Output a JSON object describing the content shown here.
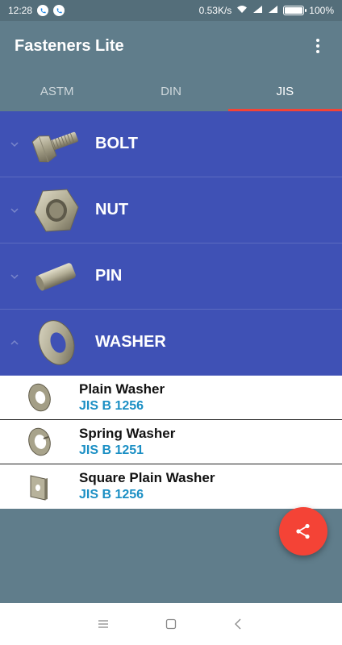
{
  "status_bar": {
    "time": "12:28",
    "speed": "0.53K/s",
    "battery_percent": "100%",
    "battery_level": 1.0
  },
  "app": {
    "title": "Fasteners Lite",
    "overflow_icon": "more-vert-icon"
  },
  "tabs": [
    {
      "label": "ASTM",
      "active": false
    },
    {
      "label": "DIN",
      "active": false
    },
    {
      "label": "JIS",
      "active": true
    }
  ],
  "categories": [
    {
      "label": "BOLT",
      "expanded": false,
      "icon": "bolt-icon"
    },
    {
      "label": "NUT",
      "expanded": false,
      "icon": "nut-icon"
    },
    {
      "label": "PIN",
      "expanded": false,
      "icon": "pin-icon"
    },
    {
      "label": "WASHER",
      "expanded": true,
      "icon": "washer-icon"
    }
  ],
  "washer_items": [
    {
      "name": "Plain Washer",
      "standard": "JIS B 1256",
      "icon": "plain-washer-icon"
    },
    {
      "name": "Spring Washer",
      "standard": "JIS B 1251",
      "icon": "spring-washer-icon"
    },
    {
      "name": "Square Plain Washer",
      "standard": "JIS B 1256",
      "icon": "square-washer-icon"
    }
  ],
  "fab": {
    "icon": "share-icon"
  },
  "nav": [
    "menu-icon",
    "home-icon",
    "back-icon"
  ],
  "colors": {
    "toolbar": "#607d8b",
    "category_bg": "#3f51b5",
    "tab_indicator": "#f44336",
    "standard_text": "#1b8fc4",
    "fab": "#f44336"
  }
}
